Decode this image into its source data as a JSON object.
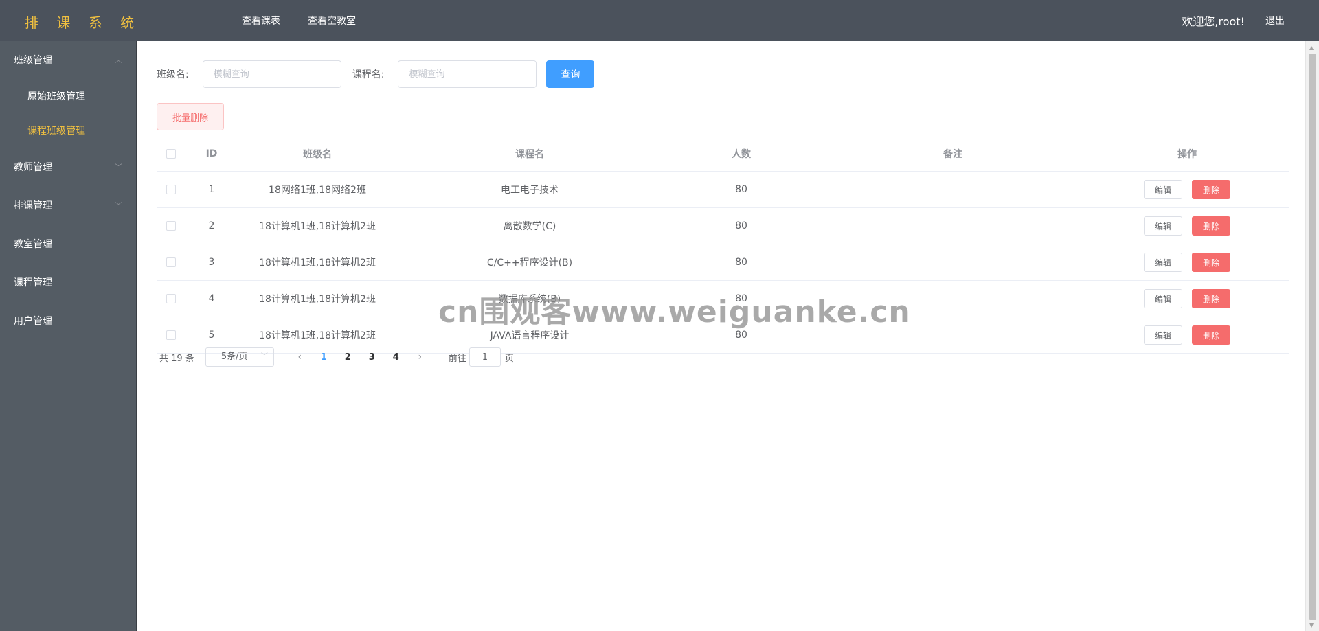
{
  "app": {
    "title": "排 课 系 统"
  },
  "topnav": {
    "items": [
      "查看课表",
      "查看空教室"
    ]
  },
  "user": {
    "welcome": "欢迎您,root!",
    "logout": "退出"
  },
  "sidebar": {
    "menus": [
      {
        "label": "班级管理",
        "expanded": true,
        "children": [
          {
            "label": "原始班级管理",
            "active": false
          },
          {
            "label": "课程班级管理",
            "active": true
          }
        ]
      },
      {
        "label": "教师管理",
        "expanded": false
      },
      {
        "label": "排课管理",
        "expanded": false
      },
      {
        "label": "教室管理"
      },
      {
        "label": "课程管理"
      },
      {
        "label": "用户管理"
      }
    ]
  },
  "search": {
    "class_label": "班级名:",
    "class_placeholder": "模糊查询",
    "course_label": "课程名:",
    "course_placeholder": "模糊查询",
    "query_button": "查询"
  },
  "toolbar": {
    "batch_delete": "批量删除"
  },
  "table": {
    "columns": [
      "ID",
      "班级名",
      "课程名",
      "人数",
      "备注",
      "操作"
    ],
    "rows": [
      {
        "id": "1",
        "class": "18网络1班,18网络2班",
        "course": "电工电子技术",
        "num": "80",
        "note": ""
      },
      {
        "id": "2",
        "class": "18计算机1班,18计算机2班",
        "course": "离散数学(C)",
        "num": "80",
        "note": ""
      },
      {
        "id": "3",
        "class": "18计算机1班,18计算机2班",
        "course": "C/C++程序设计(B)",
        "num": "80",
        "note": ""
      },
      {
        "id": "4",
        "class": "18计算机1班,18计算机2班",
        "course": "数据库系统(B)",
        "num": "80",
        "note": ""
      },
      {
        "id": "5",
        "class": "18计算机1班,18计算机2班",
        "course": "JAVA语言程序设计",
        "num": "80",
        "note": ""
      }
    ],
    "edit_label": "编辑",
    "delete_label": "删除"
  },
  "pagination": {
    "total": "共 19 条",
    "page_size": "5条/页",
    "pages": [
      "1",
      "2",
      "3",
      "4"
    ],
    "current": "1",
    "goto_prefix": "前往",
    "goto_value": "1",
    "goto_suffix": "页"
  },
  "watermark": "cn围观客www.weiguanke.cn",
  "colors": {
    "topbar": "#4b525c",
    "sidebar": "#545c64",
    "accent": "#f0c040",
    "primary": "#409eff",
    "danger": "#f56c6c"
  }
}
